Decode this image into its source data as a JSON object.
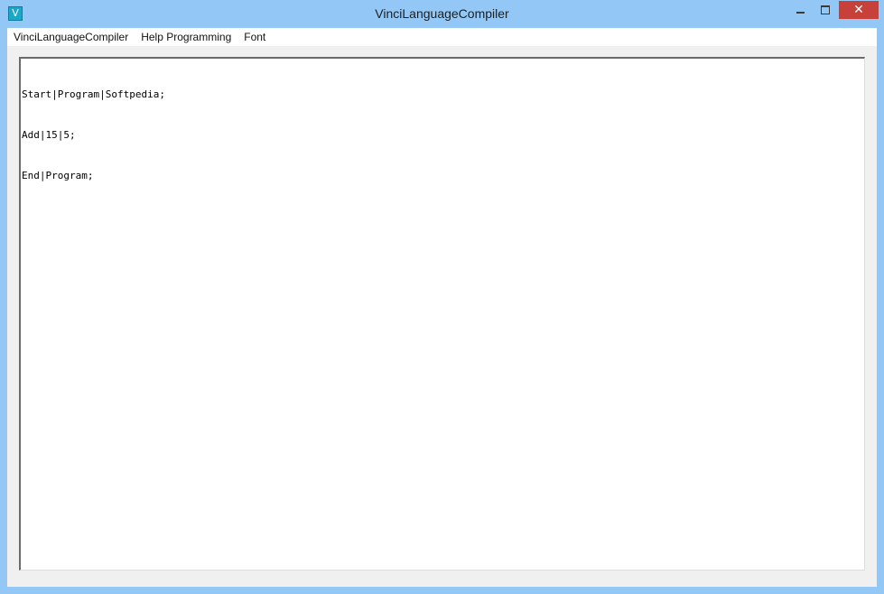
{
  "window": {
    "title": "VinciLanguageCompiler",
    "icon_letter": "V",
    "controls": {
      "minimize": "minimize-icon",
      "maximize": "maximize-icon",
      "close": "close-icon"
    },
    "colors": {
      "frame": "#93c7f6",
      "close": "#c7403a",
      "icon": "#1aa7c9"
    }
  },
  "menu": {
    "items": [
      "VinciLanguageCompiler",
      "Help Programming",
      "Font"
    ]
  },
  "editor": {
    "lines": [
      "Start|Program|Softpedia;",
      "Add|15|5;",
      "End|Program;"
    ]
  }
}
